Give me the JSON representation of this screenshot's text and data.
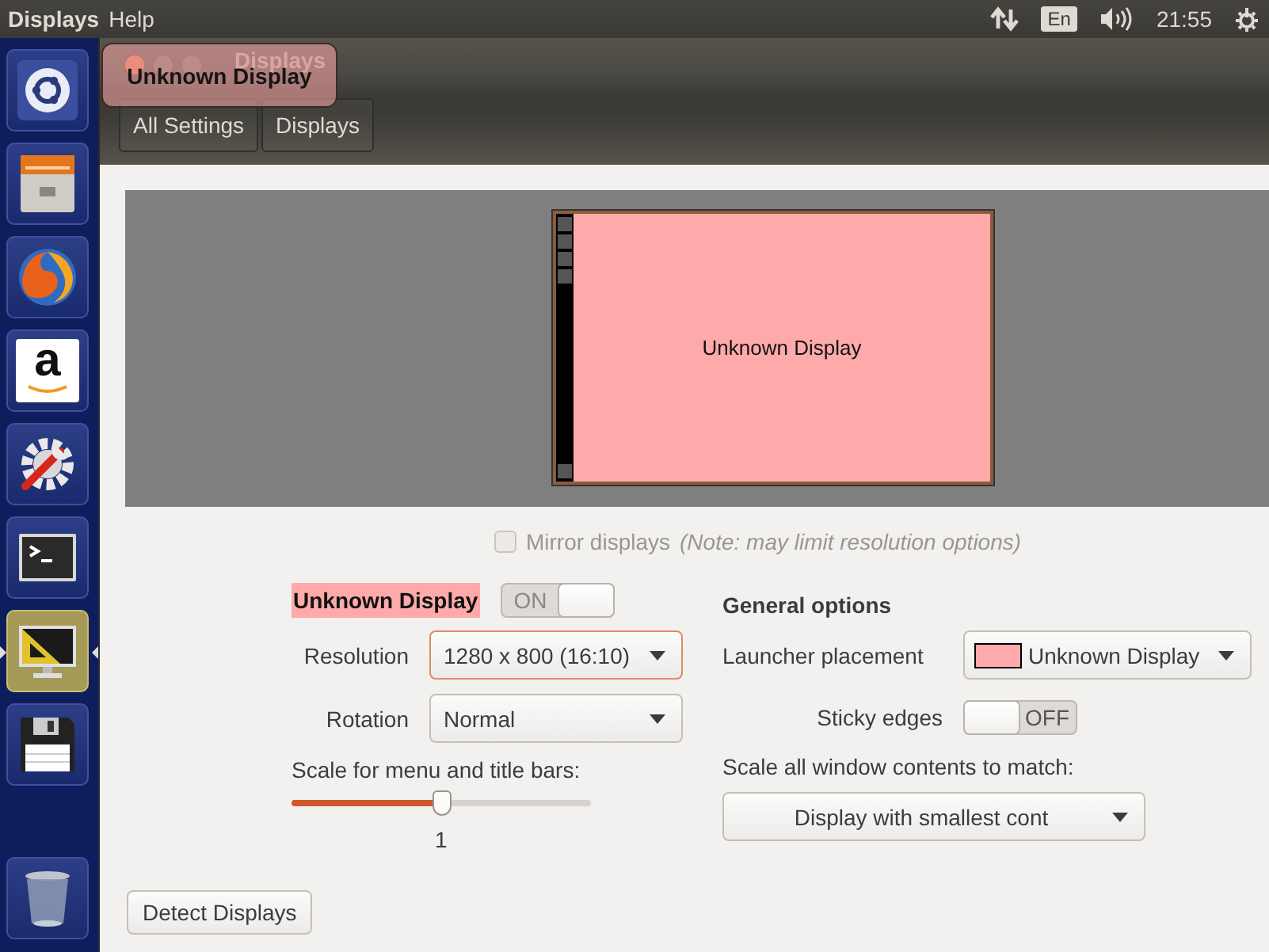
{
  "top_bar": {
    "menu": [
      {
        "label": "Displays"
      },
      {
        "label": "Help"
      }
    ],
    "keyboard_layout": "En",
    "time": "21:55"
  },
  "launcher": [
    {
      "kind": "dash",
      "selected": false
    },
    {
      "kind": "files",
      "selected": false
    },
    {
      "kind": "browser",
      "selected": false
    },
    {
      "kind": "store",
      "glyph": "a",
      "selected": false
    },
    {
      "kind": "settings",
      "selected": false
    },
    {
      "kind": "terminal",
      "selected": false
    },
    {
      "kind": "displays",
      "selected": true
    },
    {
      "kind": "disk",
      "selected": false
    },
    {
      "kind": "trash",
      "selected": false
    }
  ],
  "window": {
    "title": "Displays",
    "breadcrumbs": [
      {
        "label": "All Settings"
      },
      {
        "label": "Displays"
      }
    ]
  },
  "tooltip": "Unknown Display",
  "display": {
    "name": "Unknown Display",
    "color": "#ffaaaa",
    "preview_label": "Unknown Display",
    "switch": {
      "label": "ON",
      "on": true
    },
    "resolution": {
      "label": "Resolution",
      "value": "1280 x 800 (16:10)"
    },
    "rotation": {
      "label": "Rotation",
      "value": "Normal"
    },
    "scale": {
      "label": "Scale for menu and title bars:",
      "level": 0.5,
      "reading": "1"
    }
  },
  "mirror": {
    "label": "Mirror displays",
    "note": "(Note: may limit resolution options)",
    "checked": false,
    "disabled": true
  },
  "general": {
    "title": "General options",
    "launcher_placement": {
      "label": "Launcher placement",
      "value": "Unknown Display"
    },
    "sticky_edges": {
      "label": "Sticky edges",
      "switch": {
        "label": "OFF",
        "on": false
      }
    },
    "scale_all": {
      "label": "Scale all window contents to match:",
      "value": "Display with smallest cont"
    }
  },
  "detect_button": "Detect Displays"
}
